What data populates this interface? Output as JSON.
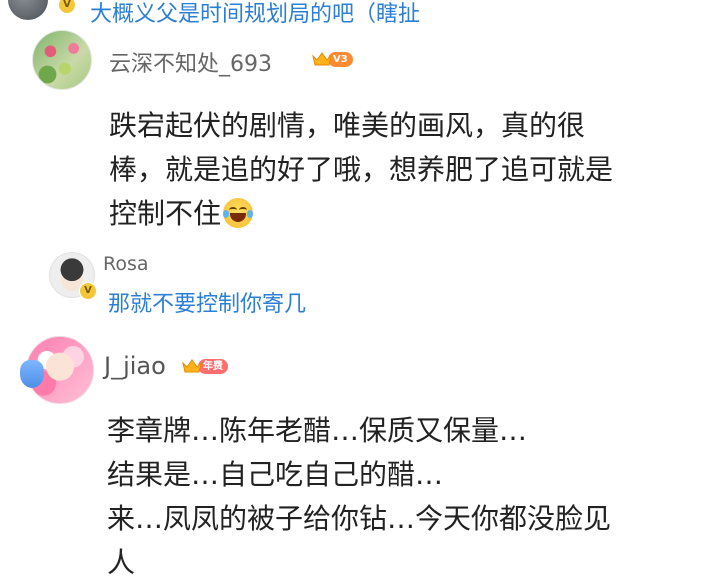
{
  "top_reply": {
    "text": "大概义父是时间规划局的吧（瞎扯"
  },
  "comment1": {
    "username": "云深不知处_693",
    "level_badge": "V3",
    "lines": [
      "跌宕起伏的剧情，唯美的画风，真的很",
      "棒，就是追的好了哦，想养肥了追可就是",
      "控制不住"
    ],
    "emoji": "laughing-tears"
  },
  "reply": {
    "username": "Rosa",
    "text": "那就不要控制你寄几"
  },
  "comment2": {
    "username": "J_jiao",
    "badge": "年费",
    "lines": [
      "李章牌…陈年老醋…保质又保量…",
      "结果是…自己吃自己的醋…",
      "来…凤凤的被子给你钻…今天你都没脸见",
      "人"
    ]
  },
  "colors": {
    "reply_text": "#2c7fd4",
    "username": "#666666",
    "body": "#222222",
    "verified_badge": "#f3c73a",
    "level_pill": "#ff8a34",
    "year_pill": "#ff6e6e"
  }
}
